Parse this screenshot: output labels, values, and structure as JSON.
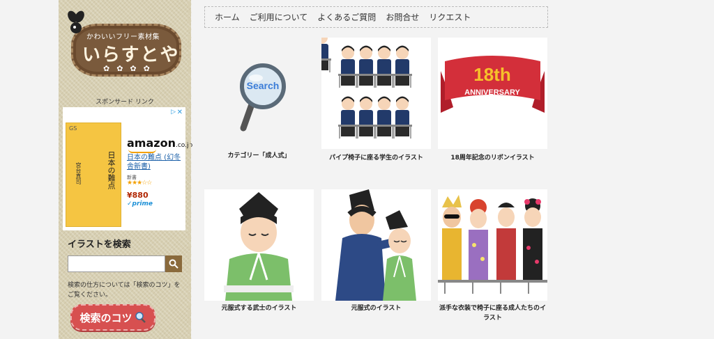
{
  "logo": {
    "subtitle": "かわいいフリー素材集",
    "title": "いらすとや",
    "flowers": "✿✿✿✿"
  },
  "sidebar": {
    "sponsored_label": "スポンサード リンク",
    "ad": {
      "gs": "GS",
      "book_title": "日本の難点",
      "book_author": "宮台真司",
      "brand": "amazon",
      "brand_suffix": ".co.jp",
      "product": "日本の難点 (幻冬舎新書)",
      "condition": "新書",
      "stars": "★★★☆☆",
      "price": "¥880",
      "prime": "✓prime",
      "adchoice": "▷",
      "close": "✕"
    },
    "search_heading": "イラストを検索",
    "search_placeholder": "",
    "search_help": "検索の仕方については「検索のコツ」をご覧ください。",
    "tips_button": "検索のコツ"
  },
  "nav": {
    "items": [
      "ホーム",
      "ご利用について",
      "よくあるご質問",
      "お問合せ",
      "リクエスト"
    ]
  },
  "cards": [
    {
      "caption": "カテゴリー「成人式」"
    },
    {
      "caption": "パイプ椅子に座る学生のイラスト"
    },
    {
      "caption": "18周年記念のリボンイラスト",
      "ribbon_number": "18th",
      "ribbon_text": "ANNIVERSARY"
    },
    {
      "caption": "元服式する武士のイラスト"
    },
    {
      "caption": "元服式のイラスト"
    },
    {
      "caption": "派手な衣装で椅子に座る成人たちのイラスト"
    }
  ],
  "search_lens_word": "Search"
}
